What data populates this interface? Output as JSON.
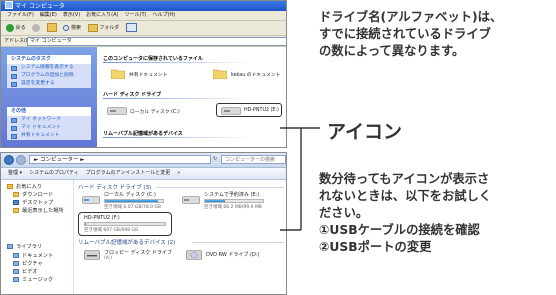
{
  "top_window": {
    "title": "マイ コンピュータ",
    "menu": [
      "ファイル(F)",
      "編集(E)",
      "表示(V)",
      "お気に入り(A)",
      "ツール(T)",
      "ヘルプ(H)"
    ],
    "toolbar": {
      "back": "戻る",
      "search": "検索",
      "folders": "フォルダ"
    },
    "address_label": "アドレス(D)",
    "address_value": "マイ コンピュータ",
    "system_tasks": {
      "header": "システムのタスク",
      "items": [
        "システム情報を表示する",
        "プログラムの追加と削除",
        "設定を変更する"
      ]
    },
    "other_places": {
      "header": "その他",
      "items": [
        "マイ ネットワーク",
        "マイ ドキュメント",
        "共有ドキュメント"
      ]
    },
    "group_stored": "このコンピュータに保存されているファイル",
    "stored_items": [
      "共有ドキュメント",
      "kekau のドキュメント"
    ],
    "group_hdd": "ハード ディスク ドライブ",
    "hdd_items": [
      "ローカル ディスク (C:)",
      "HD-PNTU2 (E:)"
    ],
    "group_removable": "リムーバブル記憶域があるデバイス"
  },
  "bottom_window": {
    "breadcrumb": "► コンピューター ►",
    "search_placeholder": "コンピューターの検索",
    "commands": [
      "整理 ▾",
      "システムのプロパティ",
      "プログラムのアンインストールと変更",
      "»"
    ],
    "nav": {
      "favorites": "お気に入り",
      "favorites_items": [
        "ダウンロード",
        "デスクトップ",
        "最近表示した場所"
      ],
      "libraries": "ライブラリ",
      "libraries_items": [
        "ドキュメント",
        "ピクチャ",
        "ビデオ",
        "ミュージック"
      ]
    },
    "section_hdd": "ハード ディスク ドライブ (3)",
    "drives": [
      {
        "name": "ローカル ディスク (C:)",
        "free": "空き領域 6.07 GB/78.0 GB",
        "used_fraction": 0.92
      },
      {
        "name": "システムで予約済み (E:)",
        "free": "空き領域 66.2 MB/99.9 MB",
        "used_fraction": 0.34
      },
      {
        "name": "HD-PNTU2 (F:)",
        "free": "空き領域 697 GB/698 GB",
        "used_fraction": 0.01
      }
    ],
    "section_removable": "リムーバブル記憶域があるデバイス (2)",
    "removable": [
      {
        "name": "フロッピー ディスク ドライブ",
        "sub": "(A:)"
      },
      {
        "name": "DVD RW ドライブ (D:)"
      }
    ]
  },
  "callouts": {
    "drive_letter": "ドライブ名(アルファベット)は、\nすでに接続されているドライブ\nの数によって異なります。",
    "icon_label": "アイコン",
    "advice": "数分待ってもアイコンが表示さ\nれないときは、以下をお試しく\nださい。\n①USBケーブルの接続を確認\n②USBポートの変更"
  }
}
